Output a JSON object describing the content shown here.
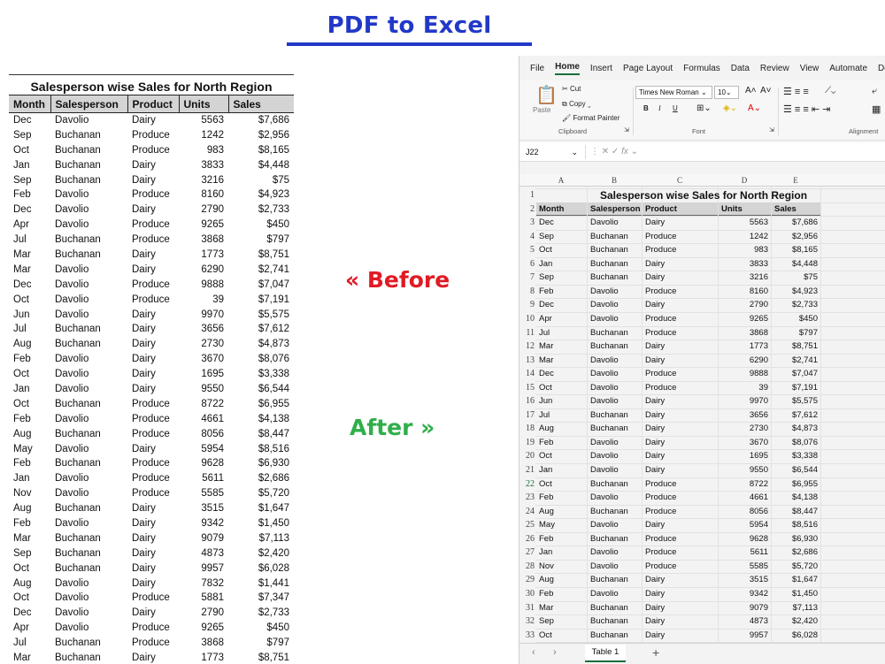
{
  "hero": {
    "title": "PDF to Excel"
  },
  "labels": {
    "before": "« Before",
    "after": "After »"
  },
  "pdf": {
    "title": "Salesperson wise Sales for North Region",
    "columns": [
      "Month",
      "Salesperson",
      "Product",
      "Units",
      "Sales"
    ],
    "rows": [
      [
        "Dec",
        "Davolio",
        "Dairy",
        "5563",
        "$7,686"
      ],
      [
        "Sep",
        "Buchanan",
        "Produce",
        "1242",
        "$2,956"
      ],
      [
        "Oct",
        "Buchanan",
        "Produce",
        "983",
        "$8,165"
      ],
      [
        "Jan",
        "Buchanan",
        "Dairy",
        "3833",
        "$4,448"
      ],
      [
        "Sep",
        "Buchanan",
        "Dairy",
        "3216",
        "$75"
      ],
      [
        "Feb",
        "Davolio",
        "Produce",
        "8160",
        "$4,923"
      ],
      [
        "Dec",
        "Davolio",
        "Dairy",
        "2790",
        "$2,733"
      ],
      [
        "Apr",
        "Davolio",
        "Produce",
        "9265",
        "$450"
      ],
      [
        "Jul",
        "Buchanan",
        "Produce",
        "3868",
        "$797"
      ],
      [
        "Mar",
        "Buchanan",
        "Dairy",
        "1773",
        "$8,751"
      ],
      [
        "Mar",
        "Davolio",
        "Dairy",
        "6290",
        "$2,741"
      ],
      [
        "Dec",
        "Davolio",
        "Produce",
        "9888",
        "$7,047"
      ],
      [
        "Oct",
        "Davolio",
        "Produce",
        "39",
        "$7,191"
      ],
      [
        "Jun",
        "Davolio",
        "Dairy",
        "9970",
        "$5,575"
      ],
      [
        "Jul",
        "Buchanan",
        "Dairy",
        "3656",
        "$7,612"
      ],
      [
        "Aug",
        "Buchanan",
        "Dairy",
        "2730",
        "$4,873"
      ],
      [
        "Feb",
        "Davolio",
        "Dairy",
        "3670",
        "$8,076"
      ],
      [
        "Oct",
        "Davolio",
        "Dairy",
        "1695",
        "$3,338"
      ],
      [
        "Jan",
        "Davolio",
        "Dairy",
        "9550",
        "$6,544"
      ],
      [
        "Oct",
        "Buchanan",
        "Produce",
        "8722",
        "$6,955"
      ],
      [
        "Feb",
        "Davolio",
        "Produce",
        "4661",
        "$4,138"
      ],
      [
        "Aug",
        "Buchanan",
        "Produce",
        "8056",
        "$8,447"
      ],
      [
        "May",
        "Davolio",
        "Dairy",
        "5954",
        "$8,516"
      ],
      [
        "Feb",
        "Buchanan",
        "Produce",
        "9628",
        "$6,930"
      ],
      [
        "Jan",
        "Davolio",
        "Produce",
        "5611",
        "$2,686"
      ],
      [
        "Nov",
        "Davolio",
        "Produce",
        "5585",
        "$5,720"
      ],
      [
        "Aug",
        "Buchanan",
        "Dairy",
        "3515",
        "$1,647"
      ],
      [
        "Feb",
        "Davolio",
        "Dairy",
        "9342",
        "$1,450"
      ],
      [
        "Mar",
        "Buchanan",
        "Dairy",
        "9079",
        "$7,113"
      ],
      [
        "Sep",
        "Buchanan",
        "Dairy",
        "4873",
        "$2,420"
      ],
      [
        "Oct",
        "Buchanan",
        "Dairy",
        "9957",
        "$6,028"
      ],
      [
        "Aug",
        "Davolio",
        "Dairy",
        "7832",
        "$1,441"
      ],
      [
        "Oct",
        "Davolio",
        "Produce",
        "5881",
        "$7,347"
      ],
      [
        "Dec",
        "Davolio",
        "Dairy",
        "2790",
        "$2,733"
      ],
      [
        "Apr",
        "Davolio",
        "Produce",
        "9265",
        "$450"
      ],
      [
        "Jul",
        "Buchanan",
        "Produce",
        "3868",
        "$797"
      ],
      [
        "Mar",
        "Buchanan",
        "Dairy",
        "1773",
        "$8,751"
      ]
    ]
  },
  "excel": {
    "menu": [
      "File",
      "Home",
      "Insert",
      "Page Layout",
      "Formulas",
      "Data",
      "Review",
      "View",
      "Automate",
      "De"
    ],
    "active_tab": "Home",
    "ribbon": {
      "cut": "Cut",
      "copy": "Copy",
      "paste": "Paste",
      "format_painter": "Format Painter",
      "clipboard": "Clipboard",
      "font_name": "Times New Roman",
      "font_size": "10",
      "font": "Font",
      "alignment": "Alignment",
      "bold": "B",
      "italic": "I",
      "underline": "U",
      "grow": "A˄",
      "shrink": "A˅"
    },
    "name_box": "J22",
    "fx": "fx",
    "col_headers": [
      "A",
      "B",
      "C",
      "D",
      "E"
    ],
    "row_numbers": [
      "1",
      "2",
      "3",
      "4",
      "5",
      "6",
      "7",
      "8",
      "9",
      "10",
      "11",
      "12",
      "13",
      "14",
      "15",
      "16",
      "17",
      "18",
      "19",
      "20",
      "21",
      "22",
      "23",
      "24",
      "25",
      "26",
      "27",
      "28",
      "29",
      "30",
      "31",
      "32",
      "33"
    ],
    "sheet_tab": "Table 1"
  }
}
